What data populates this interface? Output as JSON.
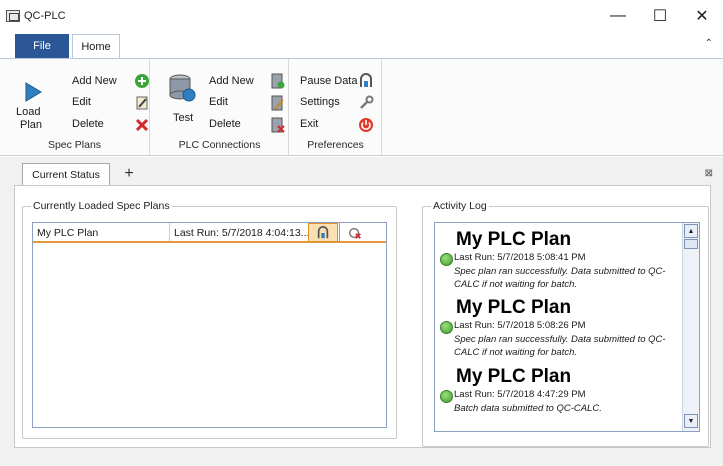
{
  "window": {
    "title": "QC-PLC",
    "minimize": "—",
    "maximize": "☐",
    "close": "✕"
  },
  "ribbon_tabs": {
    "file": "File",
    "home": "Home",
    "collapse": "⌃"
  },
  "spec_plans": {
    "label": "Spec Plans",
    "load_line1": "Load",
    "load_line2": "Plan",
    "add_new": "Add New",
    "edit": "Edit",
    "delete": "Delete"
  },
  "plc_connections": {
    "label": "PLC Connections",
    "test": "Test",
    "add_new": "Add New",
    "edit": "Edit",
    "delete": "Delete"
  },
  "preferences": {
    "label": "Preferences",
    "pause": "Pause Data",
    "settings": "Settings",
    "exit": "Exit"
  },
  "doc_tabs": {
    "current": "Current Status",
    "add": "+",
    "close_all": "⊠"
  },
  "loaded_plans": {
    "legend": "Currently Loaded Spec Plans",
    "rows": [
      {
        "name": "My PLC Plan",
        "last_run": "Last Run: 5/7/2018 4:04:13..."
      }
    ]
  },
  "activity_log": {
    "legend": "Activity Log",
    "entries": [
      {
        "title": "My PLC Plan",
        "run": "Last Run: 5/7/2018 5:08:41 PM",
        "msg": "Spec plan ran successfully.  Data submitted to QC-CALC if not waiting for batch."
      },
      {
        "title": "My PLC Plan",
        "run": "Last Run: 5/7/2018 5:08:26 PM",
        "msg": "Spec plan ran successfully.  Data submitted to QC-CALC if not waiting for batch."
      },
      {
        "title": "My PLC Plan",
        "run": "Last Run: 5/7/2018 4:47:29 PM",
        "msg": "Batch data submitted to QC-CALC."
      }
    ]
  },
  "colors": {
    "file_tab": "#2b5797",
    "highlight": "#fbe0b4",
    "status_ok": "#3f9e2d"
  }
}
